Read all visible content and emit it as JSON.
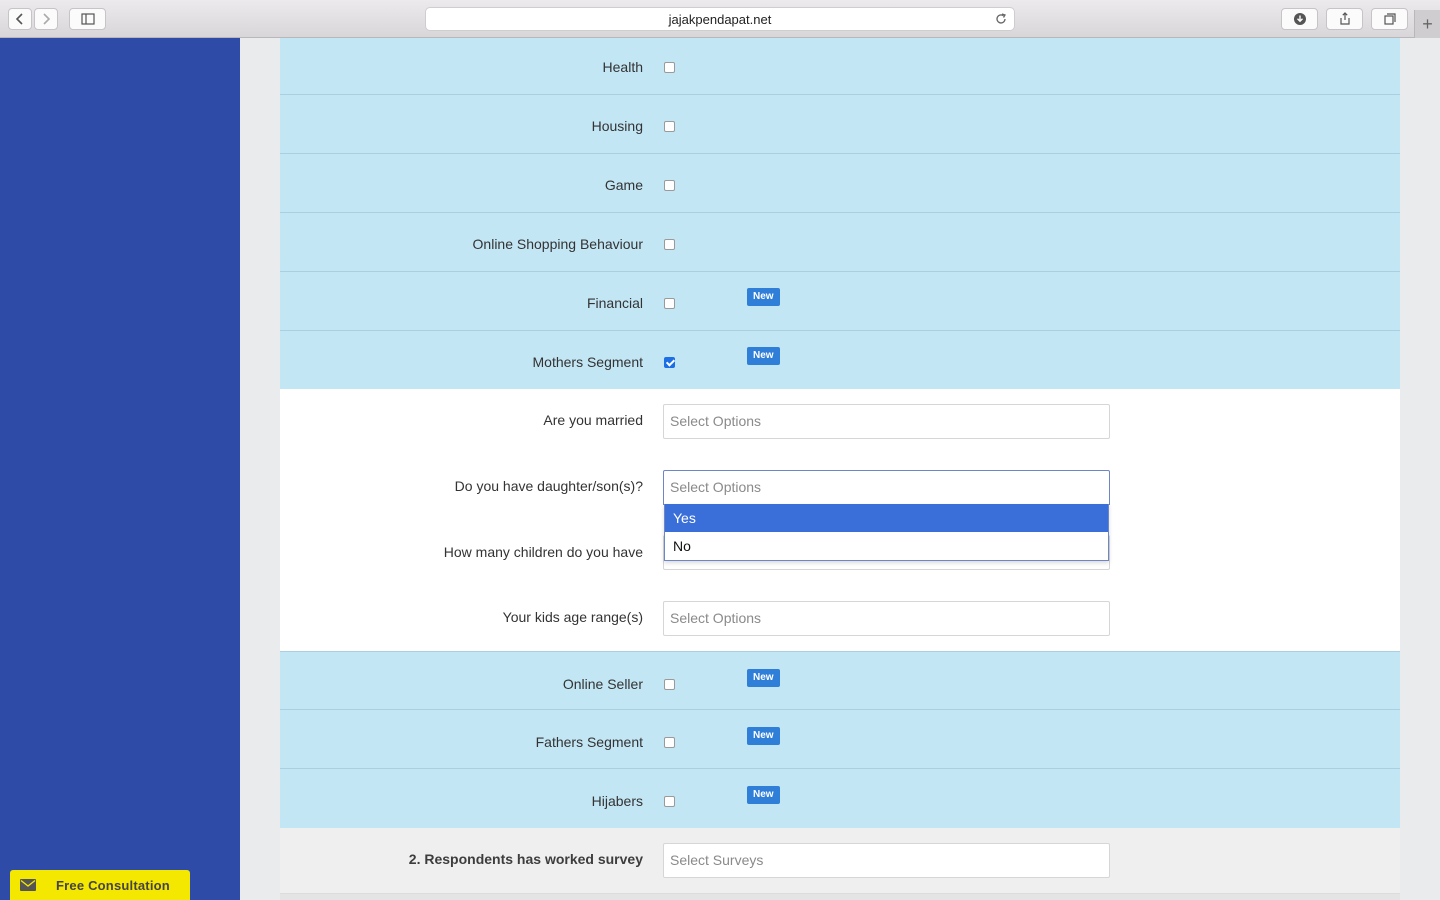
{
  "browser": {
    "url": "jajakpendapat.net",
    "icons": [
      "chevron-left-icon",
      "chevron-right-icon",
      "sidebar-icon",
      "reload-icon",
      "download-icon",
      "share-icon",
      "tabs-icon",
      "plus-icon"
    ],
    "newtab_label": "+"
  },
  "segments_top": [
    {
      "label": "Health",
      "checked": false,
      "badge": ""
    },
    {
      "label": "Housing",
      "checked": false,
      "badge": ""
    },
    {
      "label": "Game",
      "checked": false,
      "badge": ""
    },
    {
      "label": "Online Shopping Behaviour",
      "checked": false,
      "badge": ""
    },
    {
      "label": "Financial",
      "checked": false,
      "badge": "New"
    },
    {
      "label": "Mothers Segment",
      "checked": true,
      "badge": "New"
    }
  ],
  "mothers_questions": [
    {
      "label": "Are you married",
      "placeholder": "Select Options"
    },
    {
      "label": "Do you have daughter/son(s)?",
      "placeholder": "Select Options",
      "open": true
    },
    {
      "label": "How many children do you have",
      "placeholder": ""
    },
    {
      "label": "Your kids age range(s)",
      "placeholder": "Select Options"
    }
  ],
  "dropdown": {
    "options": [
      "Yes",
      "No"
    ],
    "highlighted": "Yes"
  },
  "segments_bottom": [
    {
      "label": "Online Seller",
      "checked": false,
      "badge": "New"
    },
    {
      "label": "Fathers Segment",
      "checked": false,
      "badge": "New"
    },
    {
      "label": "Hijabers",
      "checked": false,
      "badge": "New"
    }
  ],
  "worked_survey": {
    "label": "2. Respondents has worked survey",
    "placeholder": "Select Surveys"
  },
  "consultation": {
    "label": "Free Consultation",
    "icon": "mail-icon"
  },
  "colors": {
    "sidebar": "#2e4ca7",
    "row_blue": "#c3e6f5",
    "badge": "#2f7ed8",
    "highlight": "#3a6fd9",
    "consult": "#f4e700"
  }
}
